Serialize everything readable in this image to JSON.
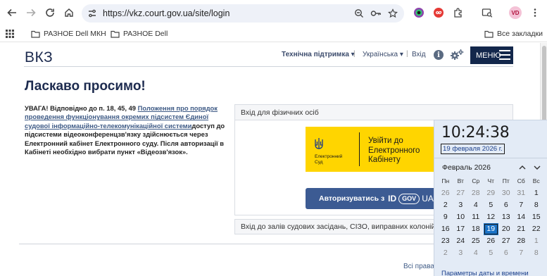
{
  "browser": {
    "url": "https://vkz.court.gov.ua/site/login",
    "profile_initials": "VD",
    "bookmarks": [
      "РАЗНОЕ Dell МКН",
      "РАЗНОЕ Dell"
    ],
    "all_bookmarks_label": "Все закладки"
  },
  "site": {
    "logo": "ВКЗ",
    "nav": {
      "support": "Технічна підтримка ▾",
      "sep": "|",
      "language": "Українська ▾",
      "login": "Вхід",
      "menu": "МЕНЮ"
    },
    "welcome": "Ласкаво просимо!",
    "notice": {
      "prefix": "УВАГА! Відповідно до п. 18, 45, 49 ",
      "link": "Положення про порядок проведення функціонування окремих підсистем Єдиної судової інформаційно-телекомунікаційної системи",
      "suffix": "доступ до підсистеми відеоконференцзв'язку здійснюється через Електронний кабінет Електронного суду. Після авторизації в Кабінеті необхідно вибрати пункт «Відеозв'язок»."
    },
    "login_panel": {
      "title": "Вхід для фізичних осіб",
      "ecourt_small_line1": "Електронний",
      "ecourt_small_line2": "Суд",
      "ecourt_big_line1": "Увійти до",
      "ecourt_big_line2": "Електронного",
      "ecourt_big_line3": "Кабінету",
      "idgov_label": "Авторизуватись з",
      "idgov_id": "ID",
      "idgov_gov": "GOV",
      "idgov_ua": "UA"
    },
    "court_halls": "Вхід до залів судових засідань, СІЗО, виправних колоній та м",
    "rights": "Всі права"
  },
  "clock_flyout": {
    "time": "10:24:38",
    "date": "19 февраля 2026 г.",
    "month": "Февраль 2026",
    "weekdays": [
      "Пн",
      "Вт",
      "Ср",
      "Чт",
      "Пт",
      "Сб",
      "Вс"
    ],
    "weeks": [
      [
        "26",
        "27",
        "28",
        "29",
        "30",
        "31",
        "1"
      ],
      [
        "2",
        "3",
        "4",
        "5",
        "6",
        "7",
        "8"
      ],
      [
        "9",
        "10",
        "11",
        "12",
        "13",
        "14",
        "15"
      ],
      [
        "16",
        "17",
        "18",
        "19",
        "20",
        "21",
        "22"
      ],
      [
        "23",
        "24",
        "25",
        "26",
        "27",
        "28",
        "1"
      ],
      [
        "2",
        "3",
        "4",
        "5",
        "6",
        "7",
        "8"
      ]
    ],
    "today": "19",
    "settings_link": "Параметры даты и времени"
  },
  "colors": {
    "accent_navy": "#13274b",
    "ecourt_yellow": "#ffd500",
    "idgov_blue": "#3c5b93",
    "today_blue": "#1a73c7"
  }
}
